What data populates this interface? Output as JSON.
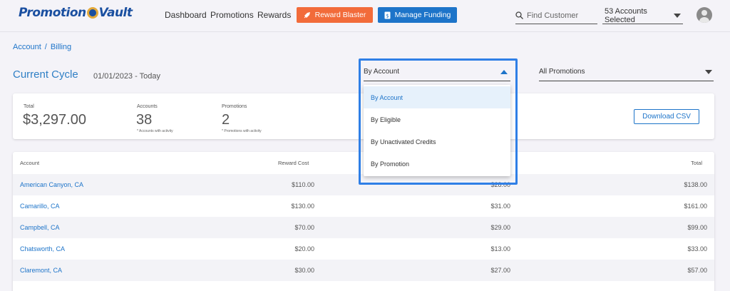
{
  "header": {
    "logo_left": "Promotion",
    "logo_right": "Vault",
    "nav": [
      "Dashboard",
      "Promotions",
      "Rewards"
    ],
    "reward_blaster_label": "Reward Blaster",
    "manage_funding_label": "Manage Funding",
    "search_placeholder": "Find Customer",
    "accounts_selected": "53 Accounts Selected"
  },
  "breadcrumb": {
    "account": "Account",
    "separator": "/",
    "billing": "Billing"
  },
  "cycle": {
    "title": "Current Cycle",
    "range": "01/01/2023 - Today"
  },
  "filters": {
    "group_by": "By Account",
    "promotions": "All Promotions",
    "group_by_options": [
      "By Account",
      "By Eligible",
      "By Unactivated Credits",
      "By Promotion"
    ]
  },
  "summary": {
    "total_label": "Total",
    "total_value": "$3,297.00",
    "accounts_label": "Accounts",
    "accounts_value": "38",
    "accounts_note": "* Accounts with activity",
    "promotions_label": "Promotions",
    "promotions_value": "2",
    "promotions_note": "* Promotions with activity",
    "download_label": "Download CSV"
  },
  "table": {
    "headers": [
      "Account",
      "Reward Cost",
      "Total"
    ],
    "rows": [
      {
        "account": "American Canyon, CA",
        "reward_cost": "$110.00",
        "fee": "$28.00",
        "total": "$138.00"
      },
      {
        "account": "Camarillo, CA",
        "reward_cost": "$130.00",
        "fee": "$31.00",
        "total": "$161.00"
      },
      {
        "account": "Campbell, CA",
        "reward_cost": "$70.00",
        "fee": "$29.00",
        "total": "$99.00"
      },
      {
        "account": "Chatsworth, CA",
        "reward_cost": "$20.00",
        "fee": "$13.00",
        "total": "$33.00"
      },
      {
        "account": "Claremont, CA",
        "reward_cost": "$30.00",
        "fee": "$27.00",
        "total": "$57.00"
      }
    ]
  },
  "colors": {
    "primary": "#1d74c9",
    "orange": "#f26b3a",
    "highlight": "#2f7fe6"
  }
}
